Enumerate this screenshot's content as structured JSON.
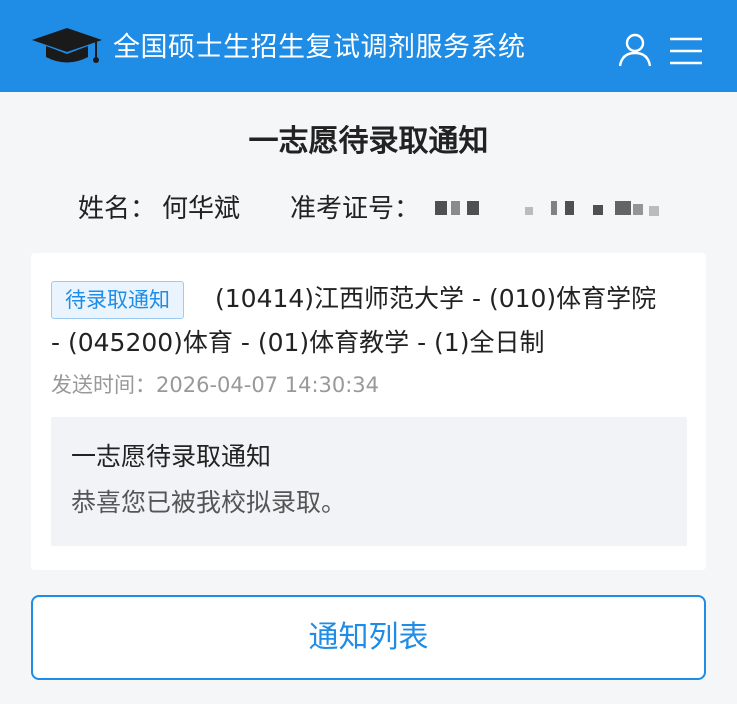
{
  "header": {
    "title": "全国硕士生招生复试调剂服务系统",
    "bg_color": "#1f8ce6",
    "logo_icon": "graduation-cap-icon",
    "user_icon": "user-icon",
    "menu_icon": "menu-icon"
  },
  "page": {
    "title": "一志愿待录取通知"
  },
  "candidate": {
    "name_label": "姓名：",
    "name_value": "何华斌",
    "exam_no_label": "准考证号："
  },
  "notice": {
    "badge": "待录取通知",
    "program_line1": "(10414)江西师范大学 - (010)体育学院",
    "program_line2": "- (045200)体育 - (01)体育教学 - (1)全日制",
    "sent_time": "发送时间：2026-04-07 14:30:34",
    "message_title": "一志愿待录取通知",
    "message_body": "恭喜您已被我校拟录取。"
  },
  "actions": {
    "list_button_label": "通知列表"
  }
}
